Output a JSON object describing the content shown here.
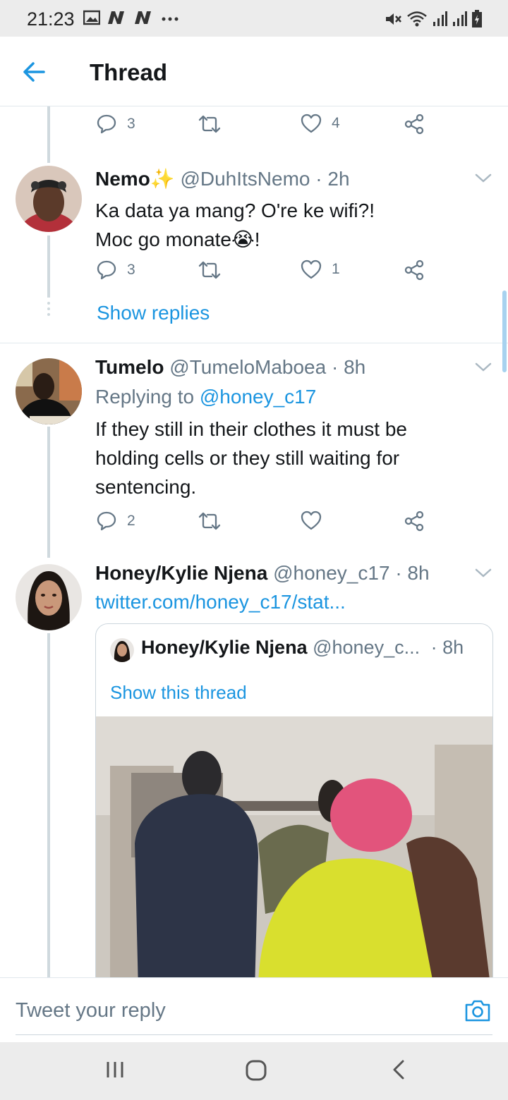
{
  "status_bar": {
    "time": "21:23",
    "left_icons": [
      "gallery-icon",
      "notification-n-icon",
      "notification-n-icon",
      "more-dots-icon"
    ],
    "right_icons": [
      "mute-icon",
      "wifi-icon",
      "signal-icon",
      "signal-icon",
      "battery-icon"
    ]
  },
  "header": {
    "title": "Thread",
    "back_icon": "arrow-left-icon"
  },
  "tweets": [
    {
      "actions": {
        "replies": "3",
        "retweets": "",
        "likes": "4"
      }
    },
    {
      "name": "Nemo",
      "name_emoji": "✨",
      "handle": "@DuhItsNemo",
      "time": "· 2h",
      "line1": "Ka data ya mang? O're ke wifi?!",
      "line2": "Moc go monate",
      "line2_emoji": "😭",
      "line2_end": "!",
      "actions": {
        "replies": "3",
        "retweets": "",
        "likes": "1"
      },
      "show_replies": "Show replies"
    },
    {
      "name": "Tumelo",
      "handle": "@TumeloMaboea",
      "time": "· 8h",
      "replying_prefix": "Replying to ",
      "replying_handle": "@honey_c17",
      "line1": "If they still in their clothes it must be",
      "line2": "holding cells or they still waiting for",
      "line3": "sentencing.",
      "actions": {
        "replies": "2",
        "retweets": "",
        "likes": ""
      }
    },
    {
      "name": "Honey/Kylie Njena",
      "handle": "@honey_c17",
      "time": "· 8h",
      "link": "twitter.com/honey_c17/stat...",
      "quote": {
        "name": "Honey/Kylie Njena",
        "handle": "@honey_c...",
        "time": "· 8h",
        "show_thread": "Show this thread"
      }
    }
  ],
  "reply": {
    "placeholder": "Tweet your reply",
    "camera_icon": "camera-icon"
  },
  "colors": {
    "accent": "#1b95e0",
    "muted": "#657786",
    "text": "#14171a",
    "divider": "#e1e8ed"
  }
}
